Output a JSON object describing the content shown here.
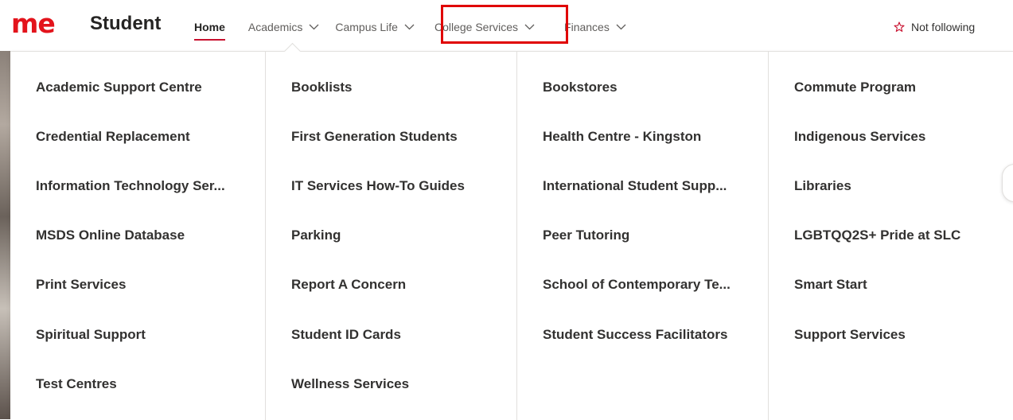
{
  "header": {
    "logo_text": "me",
    "site_title": "Student",
    "follow_label": "Not following"
  },
  "nav": [
    {
      "label": "Home"
    },
    {
      "label": "Academics"
    },
    {
      "label": "Campus Life"
    },
    {
      "label": "College Services"
    },
    {
      "label": "Finances"
    }
  ],
  "menu": {
    "columns": [
      [
        "Academic Support Centre",
        "Credential Replacement",
        "Information Technology Ser...",
        "MSDS Online Database",
        "Print Services",
        "Spiritual Support",
        "Test Centres"
      ],
      [
        "Booklists",
        "First Generation Students",
        "IT Services How-To Guides",
        "Parking",
        "Report A Concern",
        "Student ID Cards",
        "Wellness Services"
      ],
      [
        "Bookstores",
        "Health Centre - Kingston",
        "International Student Supp...",
        "Peer Tutoring",
        "School of Contemporary Te...",
        "Student Success Facilitators"
      ],
      [
        "Commute Program",
        "Indigenous Services",
        "Libraries",
        "LGBTQQ2S+ Pride at SLC",
        "Smart Start",
        "Support Services"
      ]
    ]
  },
  "colors": {
    "brand": "#e3141c",
    "highlight_box": "#e00000"
  }
}
